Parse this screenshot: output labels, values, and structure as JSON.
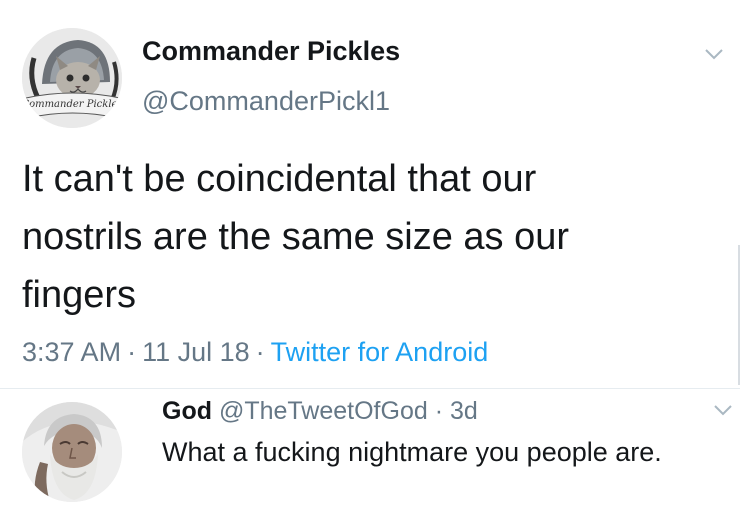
{
  "tweet": {
    "display_name": "Commander Pickles",
    "handle": "@CommanderPickl1",
    "avatar_icon": "cat-helmet-avatar",
    "avatar_text": "Commander Pickles",
    "text": "It can't be coincidental that our\nnostrils are the same size as our\nfingers",
    "time": "3:37 AM",
    "date": "11 Jul 18",
    "separator": "·",
    "source": "Twitter for Android",
    "menu_icon": "chevron-down-icon"
  },
  "reply": {
    "display_name": "God",
    "handle": "@TheTweetOfGod",
    "separator": "·",
    "age": "3d",
    "text": "What a fucking nightmare you people are.",
    "avatar_icon": "bearded-man-avatar",
    "menu_icon": "chevron-down-icon"
  },
  "colors": {
    "text": "#14171a",
    "secondary": "#657786",
    "link": "#1da1f2",
    "divider": "#e6ecf0"
  }
}
